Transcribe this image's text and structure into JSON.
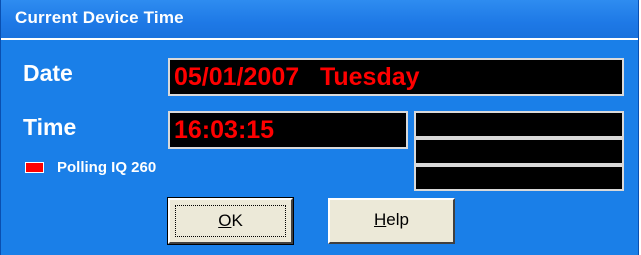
{
  "window": {
    "title": "Current Device Time"
  },
  "date": {
    "label": "Date",
    "value": "05/01/2007   Tuesday"
  },
  "time": {
    "label": "Time",
    "value": "16:03:15"
  },
  "status": {
    "indicator_color": "#FF0000",
    "text": "Polling IQ 260"
  },
  "buttons": {
    "ok": {
      "accel": "O",
      "rest": "K"
    },
    "help": {
      "accel": "H",
      "rest": "elp"
    }
  },
  "colors": {
    "background": "#1A7FE8",
    "lcd_background": "#000000",
    "lcd_text": "#FF0000"
  }
}
